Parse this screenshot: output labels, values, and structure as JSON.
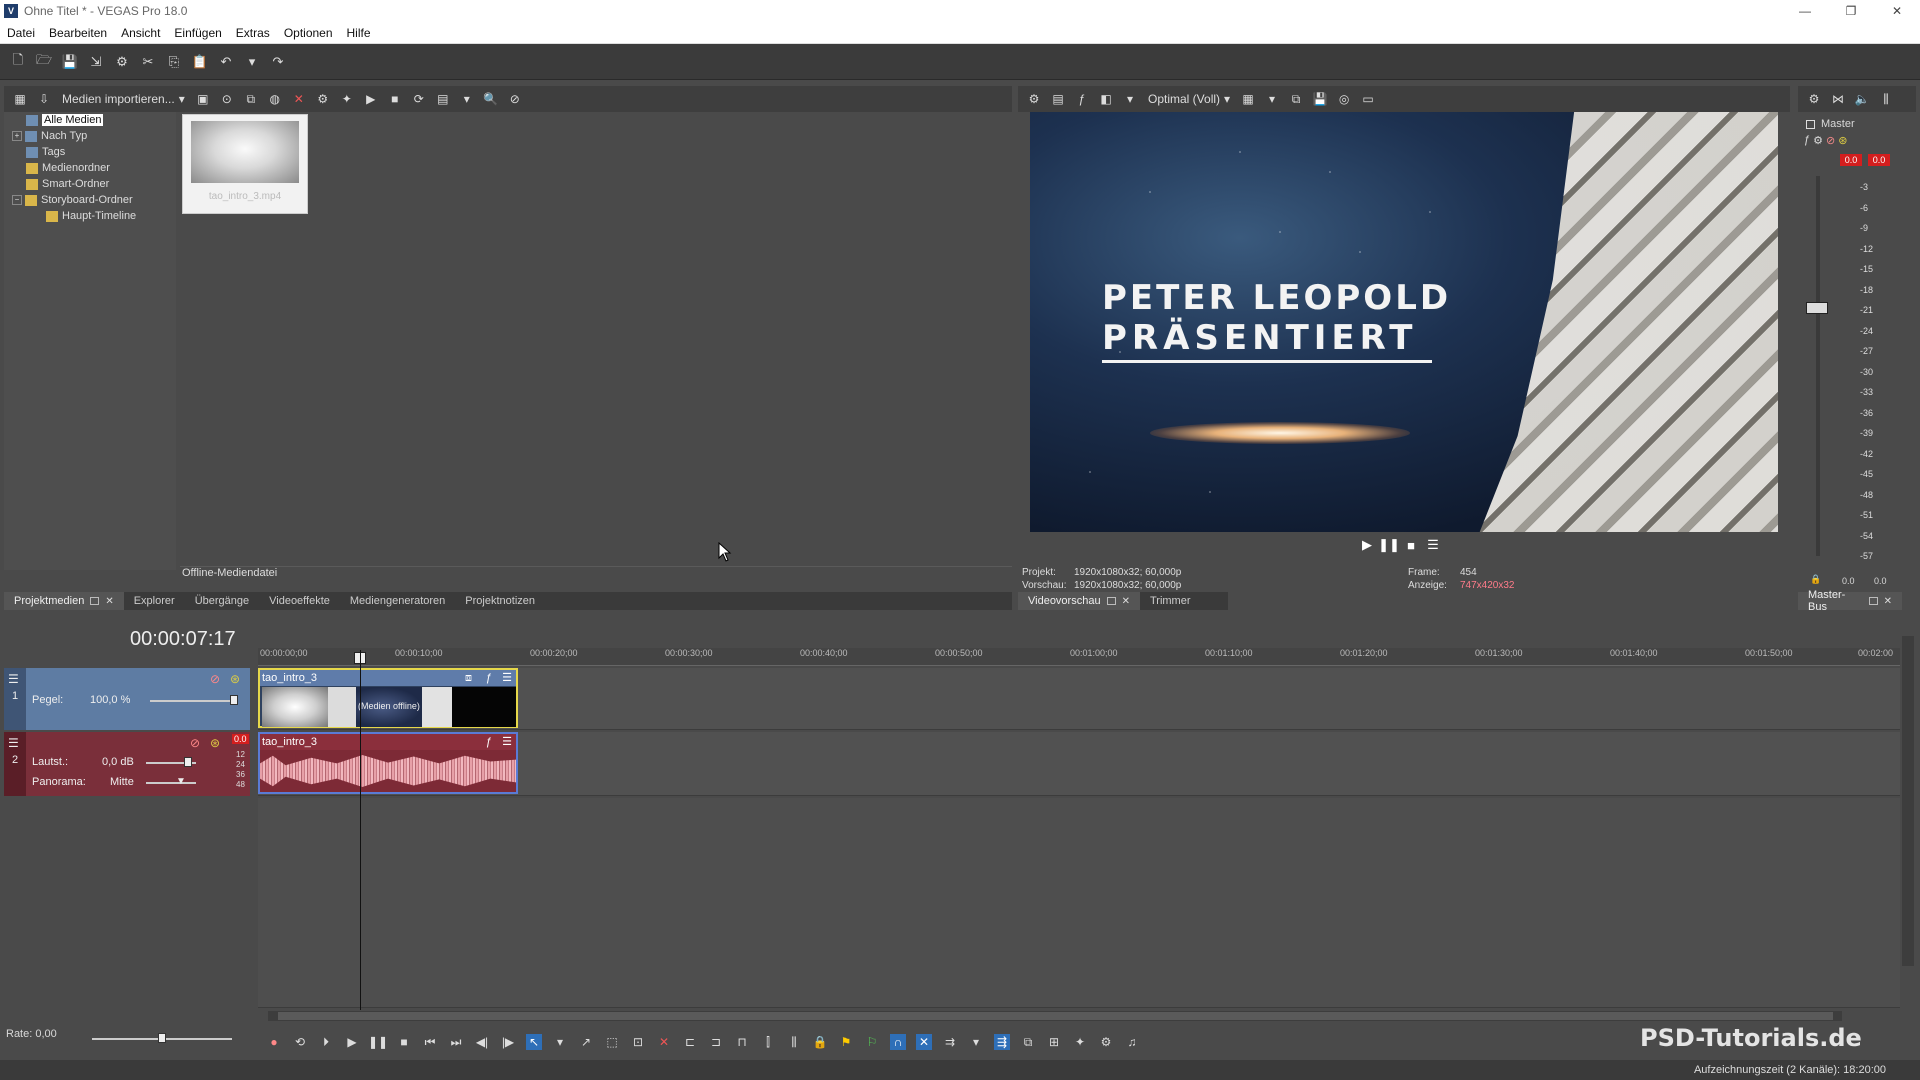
{
  "window": {
    "title": "Ohne Titel * - VEGAS Pro 18.0"
  },
  "menu": [
    "Datei",
    "Bearbeiten",
    "Ansicht",
    "Einfügen",
    "Extras",
    "Optionen",
    "Hilfe"
  ],
  "media_panel": {
    "import_label": "Medien importieren...",
    "tree": [
      "Alle Medien",
      "Nach Typ",
      "Tags",
      "Medienordner",
      "Smart-Ordner",
      "Storyboard-Ordner",
      "Haupt-Timeline"
    ],
    "thumb_label": "tao_intro_3.mp4",
    "status": "Offline-Mediendatei",
    "tabs": [
      "Projektmedien",
      "Explorer",
      "Übergänge",
      "Videoeffekte",
      "Mediengeneratoren",
      "Projektnotizen"
    ]
  },
  "preview": {
    "quality": "Optimal (Voll)",
    "title_line1": "PETER LEOPOLD",
    "title_line2": "PRÄSENTIERT",
    "info_projekt_key": "Projekt:",
    "info_projekt_val": "1920x1080x32; 60,000p",
    "info_vorschau_key": "Vorschau:",
    "info_vorschau_val": "1920x1080x32; 60,000p",
    "info_frame_key": "Frame:",
    "info_frame_val": "454",
    "info_anzeige_key": "Anzeige:",
    "info_anzeige_val": "747x420x32",
    "tabs": [
      "Videovorschau",
      "Trimmer"
    ]
  },
  "master": {
    "label": "Master",
    "peak_left": "0.0",
    "peak_right": "0.0",
    "scale": [
      "-3",
      "-6",
      "-9",
      "-12",
      "-15",
      "-18",
      "-21",
      "-24",
      "-27",
      "-30",
      "-33",
      "-36",
      "-39",
      "-42",
      "-45",
      "-48",
      "-51",
      "-54",
      "-57"
    ],
    "bottom_left": "0.0",
    "bottom_right": "0.0",
    "tab": "Master-Bus"
  },
  "timeline": {
    "timecode": "00:00:07:17",
    "ruler": [
      "00:00:00;00",
      "00:00:10;00",
      "00:00:20;00",
      "00:00:30;00",
      "00:00:40;00",
      "00:00:50;00",
      "00:01:00;00",
      "00:01:10;00",
      "00:01:20;00",
      "00:01:30;00",
      "00:01:40;00",
      "00:01:50;00",
      "00:02:00"
    ],
    "track1": {
      "num": "1",
      "label": "Pegel:",
      "value": "100,0 %",
      "clip": "tao_intro_3",
      "offline": "(Medien offline)"
    },
    "track2": {
      "num": "2",
      "vol_label": "Lautst.:",
      "vol_value": "0,0 dB",
      "pan_label": "Panorama:",
      "pan_value": "Mitte",
      "clip": "tao_intro_3",
      "peak": "0.0",
      "db_scale": [
        "12",
        "24",
        "36",
        "48"
      ]
    }
  },
  "bottom": {
    "rate": "Rate: 0,00",
    "status": "Aufzeichnungszeit (2 Kanäle): 18:20:00",
    "watermark": "PSD-Tutorials.de"
  }
}
